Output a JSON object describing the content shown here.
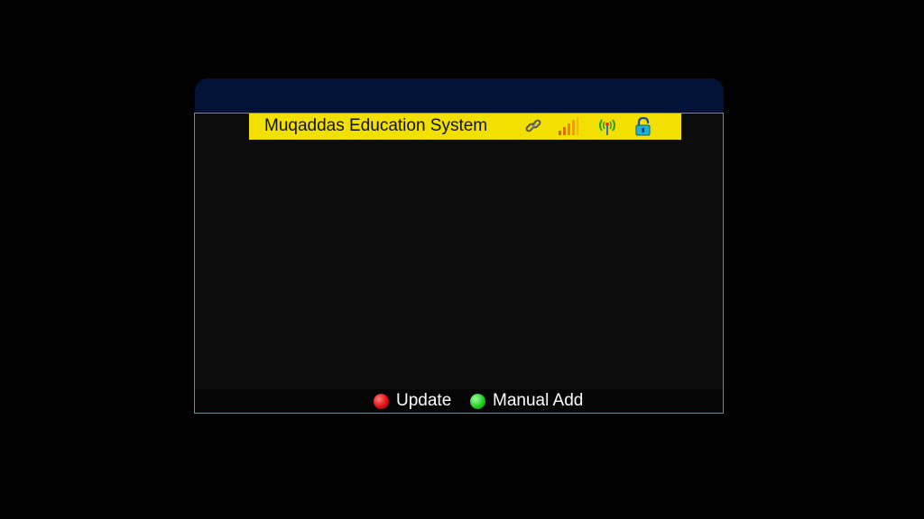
{
  "window": {
    "title": "Muqaddas Education System"
  },
  "status_icons": [
    {
      "icon": "link-icon"
    },
    {
      "icon": "signal-strength-icon"
    },
    {
      "icon": "antenna-broadcast-icon"
    },
    {
      "icon": "lock-icon"
    }
  ],
  "footer": {
    "update_label": "Update",
    "update_color": "#e01010",
    "manual_add_label": "Manual Add",
    "manual_add_color": "#22d022"
  },
  "colors": {
    "title_bar": "#f2e000",
    "header": "#031338",
    "body": "#0c0c0c",
    "border": "#6f8b95"
  }
}
